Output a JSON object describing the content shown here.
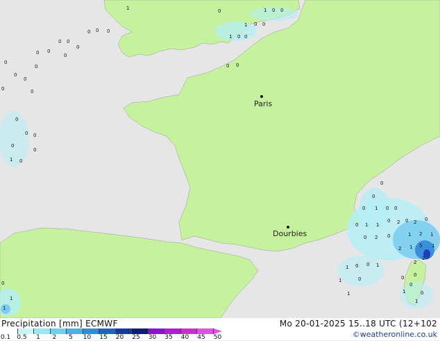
{
  "map": {
    "cities": [
      {
        "name": "Paris"
      },
      {
        "name": "Dourbies"
      }
    ],
    "precip_values": [
      "0",
      "1",
      "0",
      "0",
      "1",
      "0",
      "0",
      "1",
      "0",
      "0",
      "0",
      "0",
      "0",
      "0",
      "0",
      "1",
      "0",
      "0",
      "0",
      "0",
      "0",
      "0",
      "0",
      "0",
      "0",
      "0",
      "0",
      "0",
      "0",
      "0",
      "0",
      "0",
      "0",
      "1",
      "0",
      "0",
      "0",
      "0",
      "1",
      "0",
      "0",
      "0",
      "1",
      "1",
      "0",
      "2",
      "0",
      "2",
      "0",
      "0",
      "2",
      "0",
      "1",
      "2",
      "1",
      "2",
      "1",
      "5",
      "1",
      "2",
      "2",
      "1",
      "0",
      "0",
      "1",
      "1",
      "0",
      "1",
      "0",
      "0",
      "0",
      "0",
      "1",
      "1",
      "0",
      "1",
      "1"
    ],
    "colors": {
      "land": "#c6f29f",
      "sea": "#e6e6e6",
      "precip_light": "#b4eef5",
      "precip_mid": "#7ccdef",
      "precip_heavy": "#3a8fdc",
      "precip_max": "#1f3fb8"
    }
  },
  "footer": {
    "title_left": "Precipitation [mm] ECMWF",
    "title_right": "Mo 20-01-2025 15..18 UTC (12+102",
    "credit": "©weatheronline.co.uk",
    "scale_ticks": [
      "0.1",
      "0.5",
      "1",
      "2",
      "5",
      "10",
      "15",
      "20",
      "25",
      "30",
      "35",
      "40",
      "45",
      "50"
    ],
    "scale_colors": [
      "#ffffff",
      "#c8f4f8",
      "#9ae6f2",
      "#6ccfee",
      "#44b2e6",
      "#2a8edc",
      "#1d64c8",
      "#1537a6",
      "#0d1a7c",
      "#8a10d8",
      "#b618e0",
      "#d22ad6",
      "#e64be6"
    ]
  }
}
